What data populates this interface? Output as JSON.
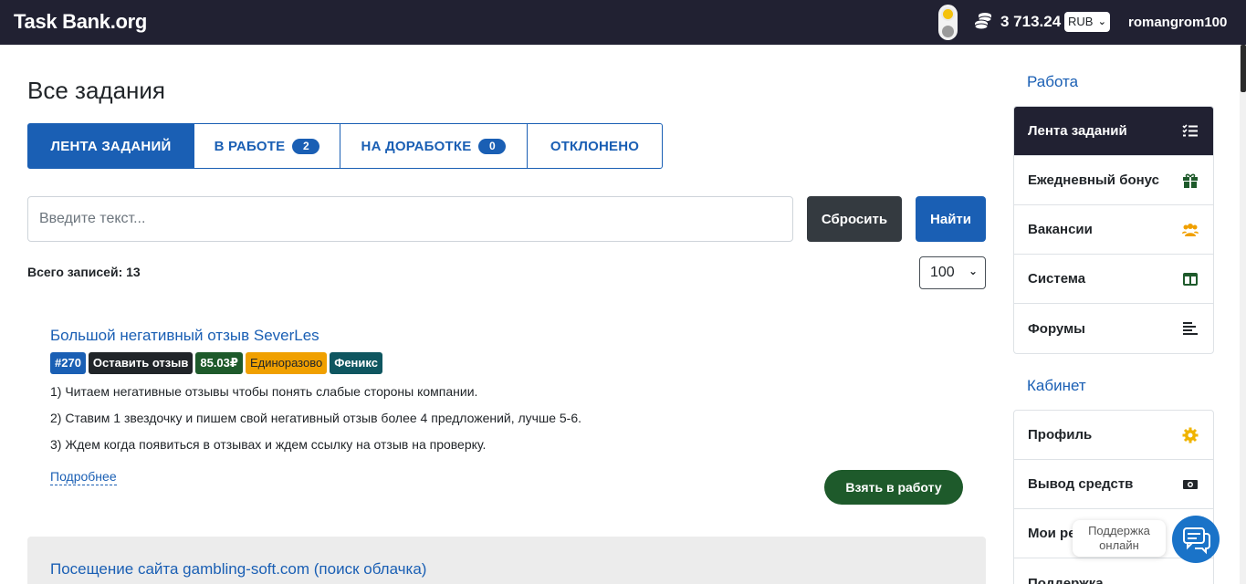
{
  "header": {
    "brand": "Task Bank.org",
    "balance": "3 713.24",
    "currency": "RUB",
    "username": "romangrom100"
  },
  "main": {
    "title": "Все задания",
    "tabs": [
      {
        "label": "ЛЕНТА ЗАДАНИЙ",
        "badge": null,
        "active": true
      },
      {
        "label": "В РАБОТЕ",
        "badge": "2",
        "active": false
      },
      {
        "label": "НА ДОРАБОТКЕ",
        "badge": "0",
        "active": false
      },
      {
        "label": "ОТКЛОНЕНО",
        "badge": null,
        "active": false
      }
    ],
    "search": {
      "placeholder": "Введите текст...",
      "value": "",
      "reset_label": "Сбросить",
      "find_label": "Найти"
    },
    "total_label": "Всего записей: 13",
    "per_page": "100",
    "tasks": [
      {
        "title": "Большой негативный отзыв SeverLes",
        "tags": {
          "id": "#270",
          "type": "Оставить отзыв",
          "price": "85.03₽",
          "frequency": "Единоразово",
          "client": "Феникс"
        },
        "lines": [
          "1) Читаем негативные отзывы чтобы понять слабые стороны компании.",
          "2) Ставим 1 звездочку и пишем свой негативный отзыв более 4 предложений, лучше 5-6.",
          "3) Ждем когда появиться в отзывах и ждем ссылку на отзыв на проверку."
        ],
        "more_label": "Подробнее",
        "take_label": "Взять в работу"
      },
      {
        "title": "Посещение сайта gambling-soft.com (поиск облачка)"
      }
    ]
  },
  "sidebar": {
    "work_title": "Работа",
    "work_items": [
      {
        "label": "Лента заданий",
        "icon": "task-list-icon",
        "active": true
      },
      {
        "label": "Ежедневный бонус",
        "icon": "gift-icon",
        "active": false
      },
      {
        "label": "Вакансии",
        "icon": "users-icon",
        "active": false
      },
      {
        "label": "Система",
        "icon": "columns-icon",
        "active": false
      },
      {
        "label": "Форумы",
        "icon": "align-left-icon",
        "active": false
      }
    ],
    "cabinet_title": "Кабинет",
    "cabinet_items": [
      {
        "label": "Профиль",
        "icon": "gear-icon"
      },
      {
        "label": "Вывод средств",
        "icon": "money-icon"
      },
      {
        "label": "Мои ре",
        "icon": ""
      },
      {
        "label": "Поддержка",
        "icon": "headset-icon"
      }
    ]
  },
  "chat": {
    "tooltip_line1": "Поддержка",
    "tooltip_line2": "онлайн"
  },
  "colors": {
    "navbar": "#212132",
    "primary": "#1a5fb4",
    "success": "#1e5a2b",
    "warning": "#f0a000"
  }
}
